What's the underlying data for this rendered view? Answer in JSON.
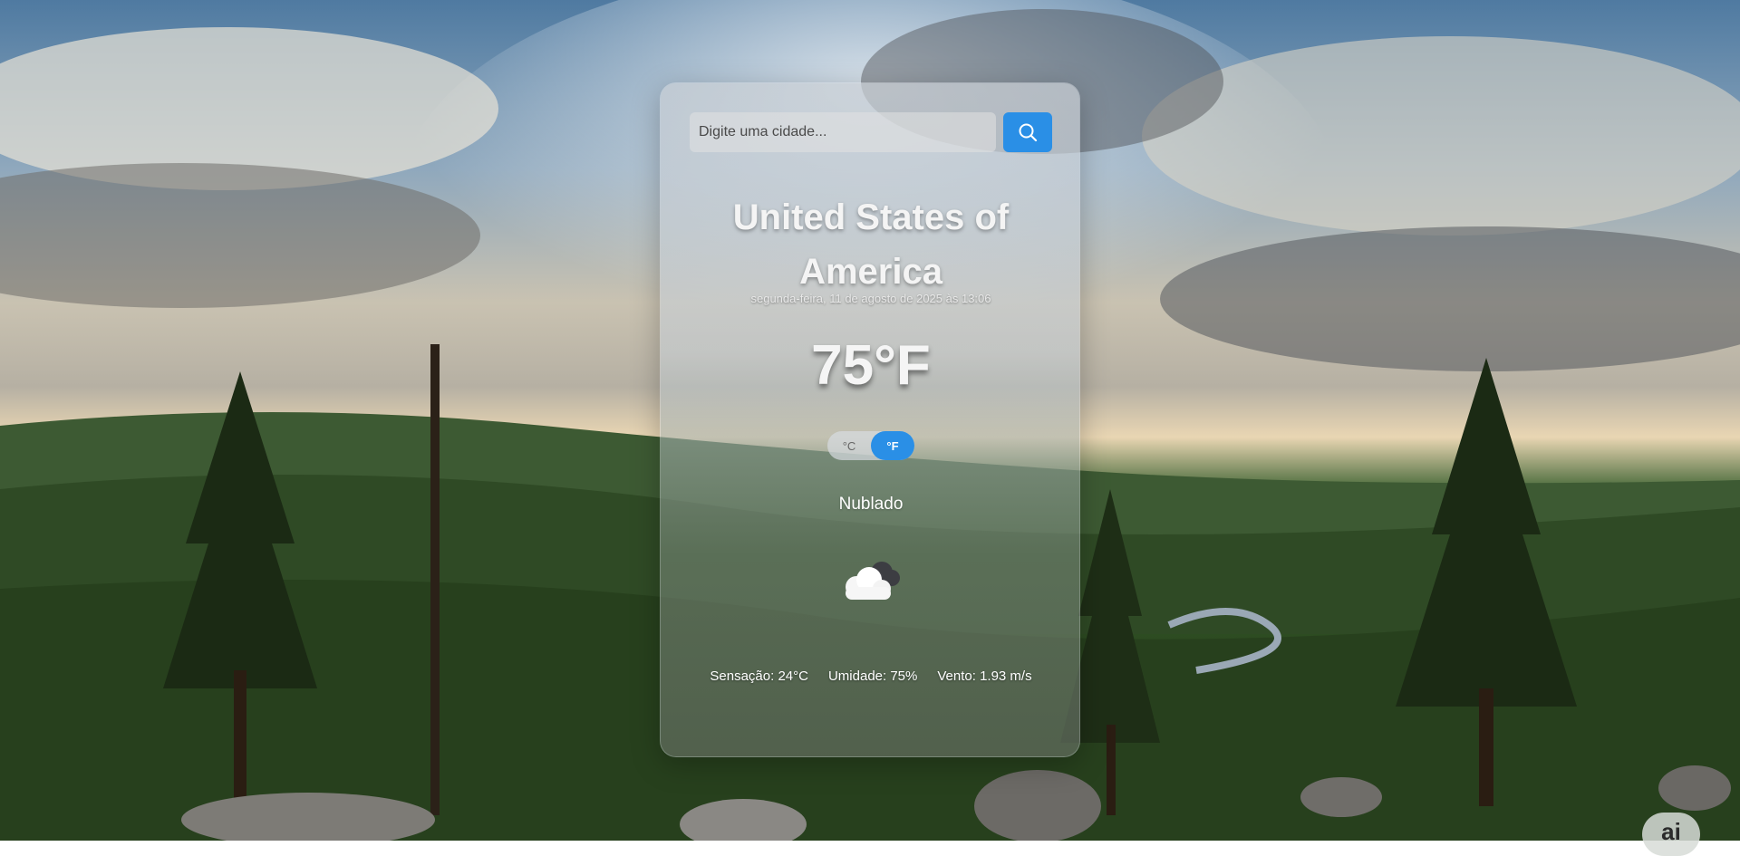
{
  "search": {
    "placeholder": "Digite uma cidade...",
    "value": ""
  },
  "location": {
    "city": "United States of America",
    "datetime": "segunda-feira, 11 de agosto de 2025 às 13:06"
  },
  "weather": {
    "temperature": "75°F",
    "description": "Nublado",
    "icon": "cloudy-icon"
  },
  "units": {
    "celsius_label": "°C",
    "fahrenheit_label": "°F",
    "selected": "fahrenheit"
  },
  "details": {
    "feels_like": "Sensação: 24°C",
    "humidity": "Umidade: 75%",
    "wind": "Vento: 1.93 m/s"
  },
  "badge": {
    "label": "ai"
  },
  "colors": {
    "accent": "#2a8fe6"
  }
}
